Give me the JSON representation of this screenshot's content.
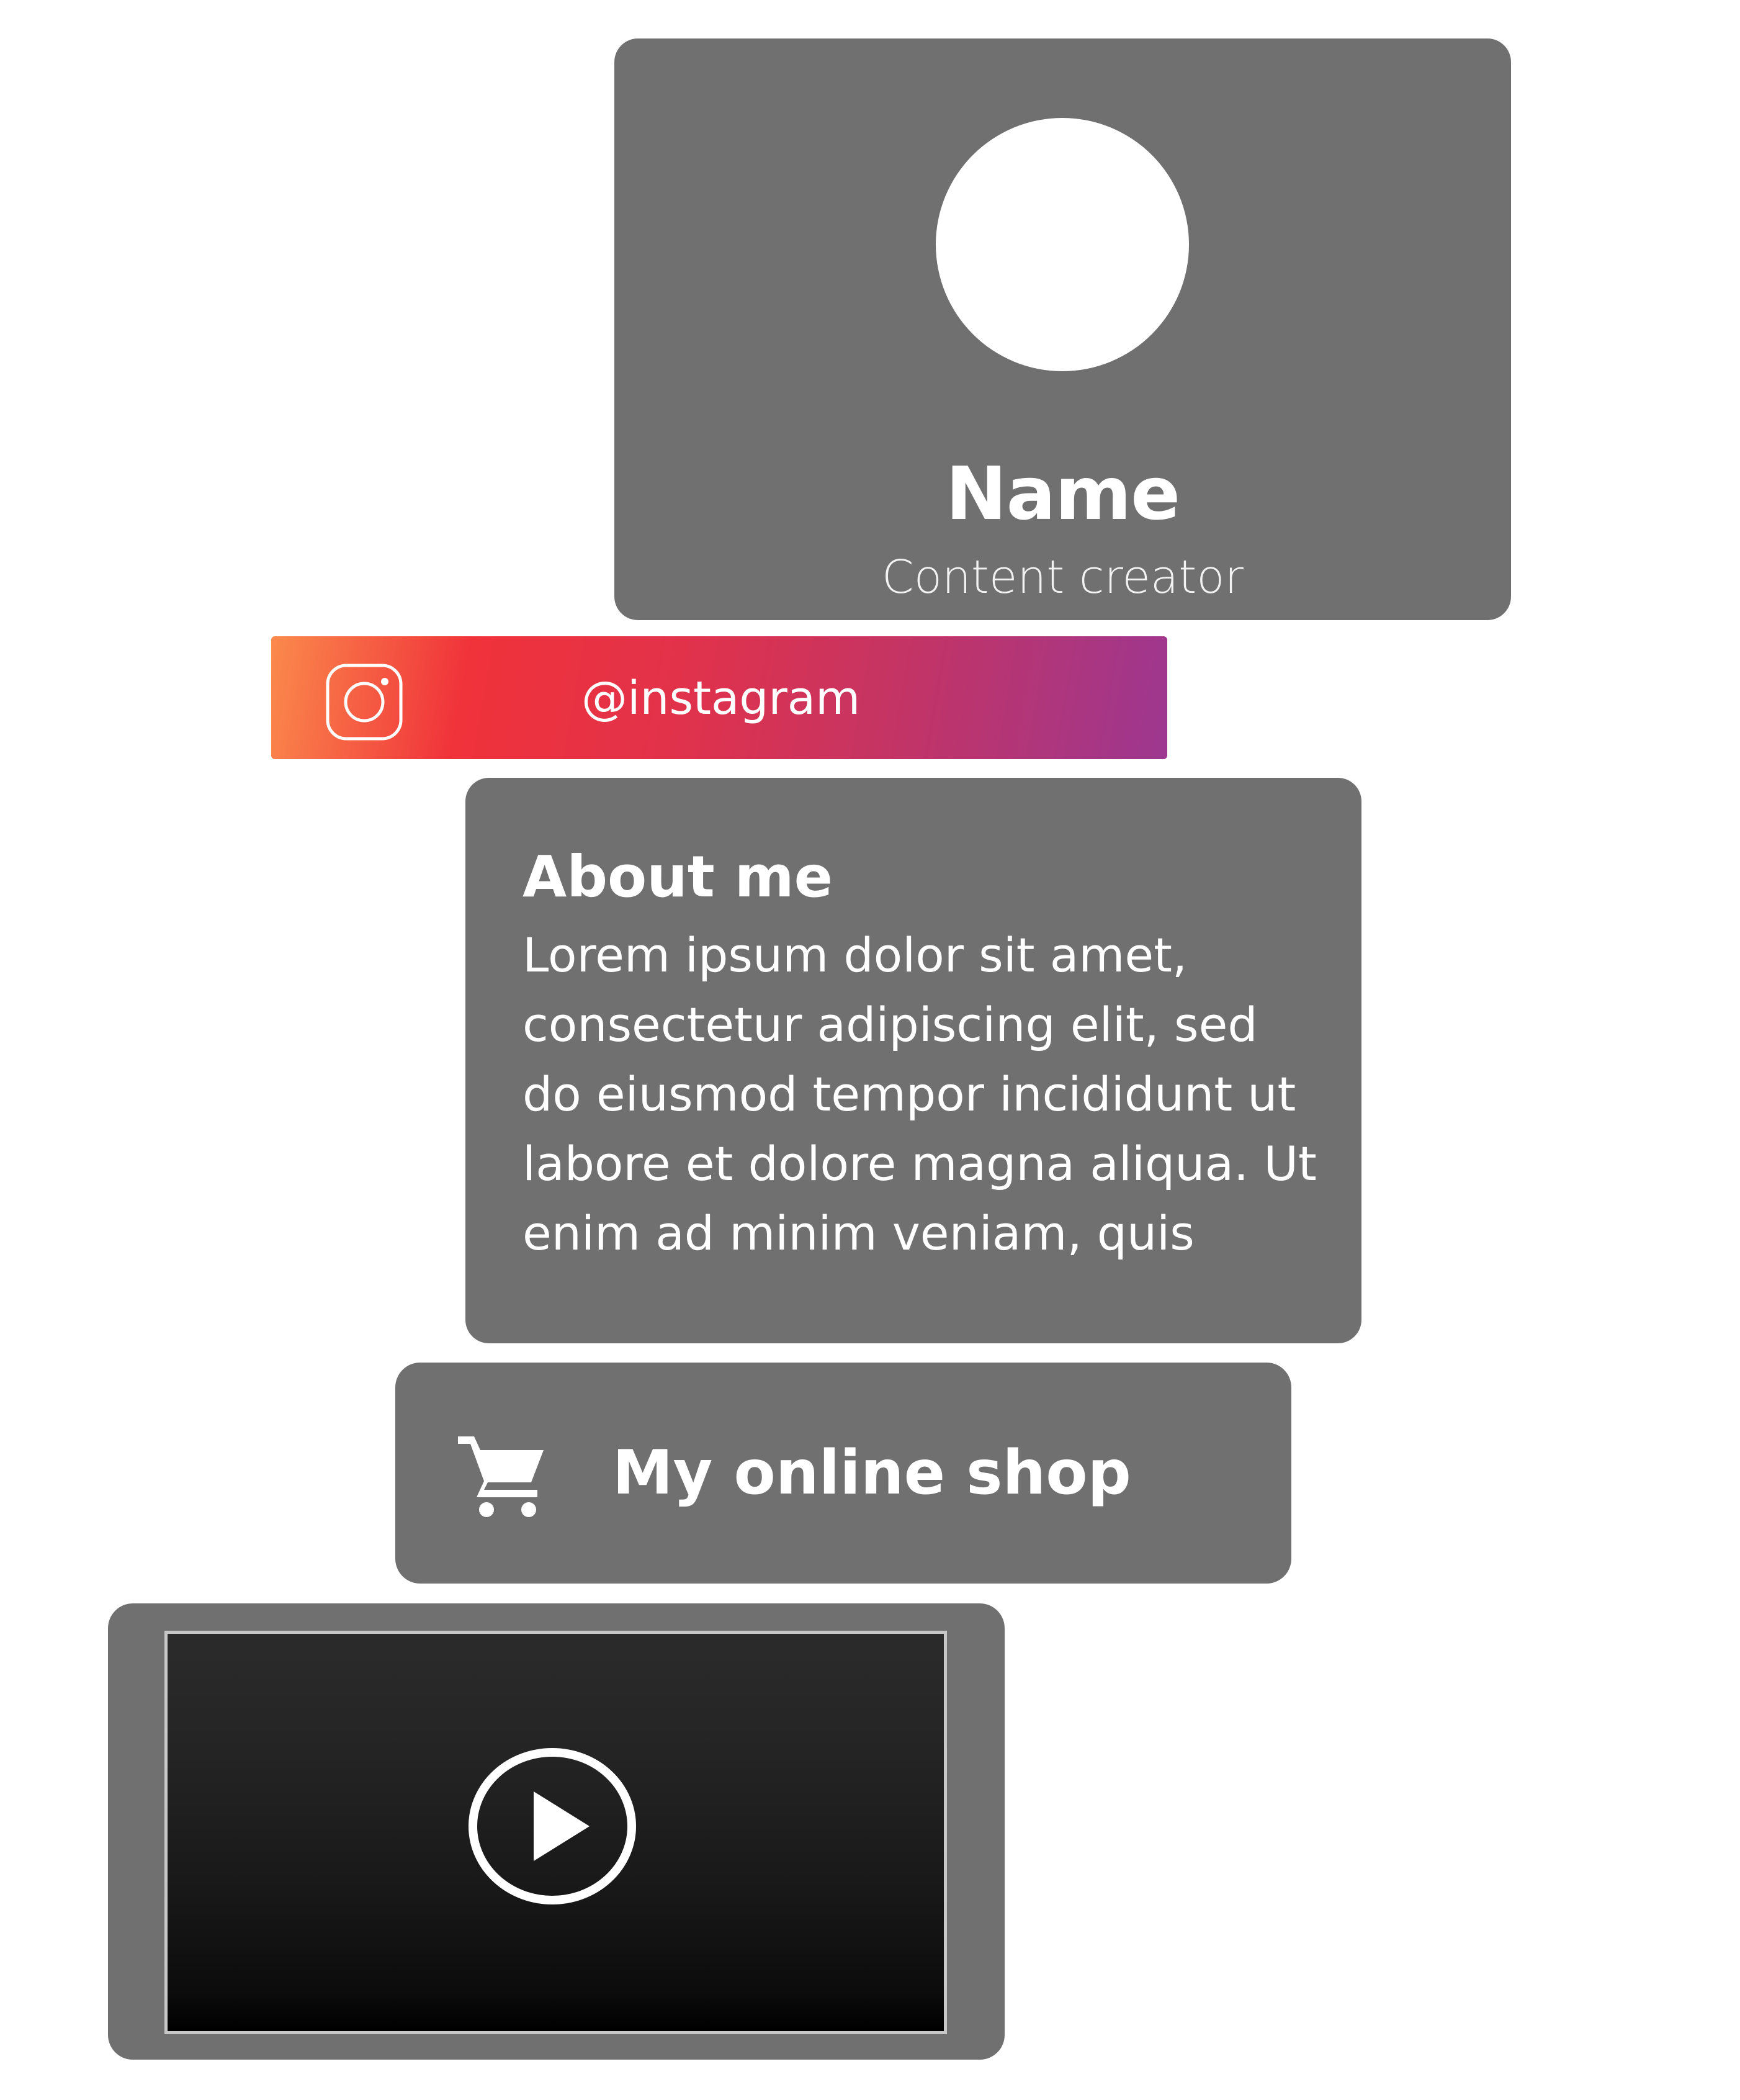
{
  "profile": {
    "name": "Name",
    "role": "Content creator"
  },
  "instagram": {
    "icon": "instagram-icon",
    "handle": "@instagram",
    "gradient_colors": [
      "#fb8a4c",
      "#f0323a",
      "#c33465",
      "#9d3790"
    ]
  },
  "about": {
    "title": "About me",
    "body": "Lorem ipsum dolor sit amet, consectetur adipiscing elit, sed do eiusmod tempor incididunt ut labore et dolore magna aliqua. Ut enim ad minim veniam, quis"
  },
  "shop": {
    "icon": "shopping-cart-icon",
    "label": "My online shop"
  },
  "video": {
    "icon": "play-icon"
  },
  "colors": {
    "card_background": "#707070",
    "page_background": "#ffffff",
    "text": "#ffffff"
  }
}
